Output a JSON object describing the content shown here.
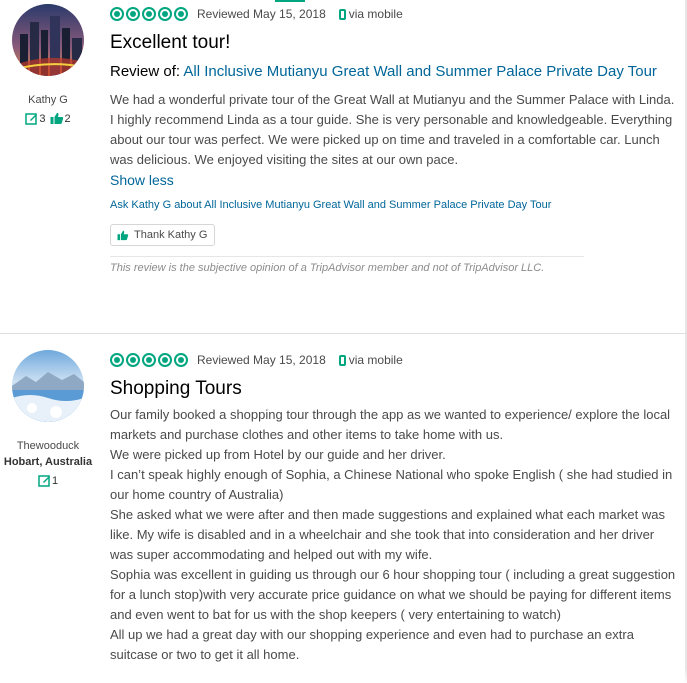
{
  "colors": {
    "accent": "#00a680",
    "link": "#006699",
    "text": "#4a4a4a"
  },
  "reviews": [
    {
      "reviewer": {
        "name": "Kathy G",
        "location": "",
        "review_count": "3",
        "helpful_count": "2"
      },
      "rating_bubbles": 5,
      "date": "Reviewed May 15, 2018",
      "via": "via mobile",
      "title": "Excellent tour!",
      "review_of_label": "Review of:",
      "review_of_link": "All Inclusive Mutianyu Great Wall and Summer Palace Private Day Tour",
      "body": [
        "We had a wonderful private tour of the Great Wall at Mutianyu and the Summer Palace with Linda. I highly recommend Linda as a tour guide. She is very personable and knowledgeable. Everything about our tour was perfect. We were picked up on time and traveled in a comfortable car. Lunch was delicious. We enjoyed visiting the sites at our own pace."
      ],
      "show_less": "Show less",
      "ask_link": "Ask Kathy G about All Inclusive Mutianyu Great Wall and Summer Palace Private Day Tour",
      "thank_button": "Thank Kathy G",
      "disclaimer": "This review is the subjective opinion of a TripAdvisor member and not of TripAdvisor LLC."
    },
    {
      "reviewer": {
        "name": "Thewooduck",
        "location": "Hobart, Australia",
        "review_count": "1"
      },
      "rating_bubbles": 5,
      "date": "Reviewed May 15, 2018",
      "via": "via mobile",
      "title": "Shopping Tours",
      "body": [
        "Our family booked a shopping tour through the app as we wanted to experience/ explore the local markets and purchase clothes and other items to take home with us.",
        "We were picked up from Hotel by our guide and her driver.",
        "I can’t speak highly enough of Sophia, a Chinese National who spoke English ( she had studied in our home country of Australia)",
        "She asked what we were after and then made suggestions and explained what each market was like. My wife is disabled and in a wheelchair and she took that into consideration and her driver was super accommodating and helped out with my wife.",
        "Sophia was excellent in guiding us through our 6 hour shopping tour ( including a great suggestion for a lunch stop)with very accurate price guidance on what we should be paying for different items and even went to bat for us with the shop keepers ( very entertaining to watch)",
        "All up we had a great day with our shopping experience and even had to purchase an extra suitcase or two to get it all home."
      ]
    }
  ]
}
